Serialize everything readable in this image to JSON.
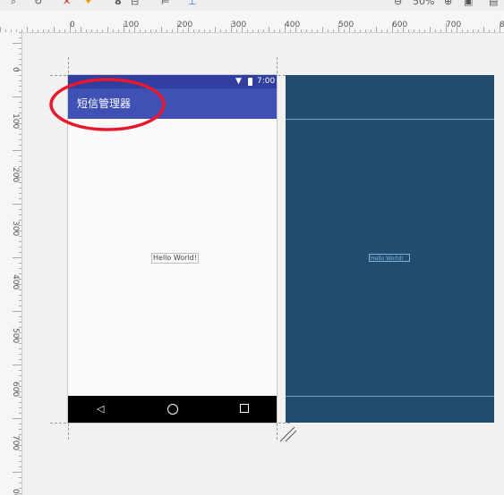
{
  "toolbar": {
    "zoom_label": "50%"
  },
  "ruler": {
    "top_labels": [
      "0",
      "100",
      "200",
      "300",
      "400",
      "500",
      "600",
      "700",
      "8"
    ],
    "left_labels": [
      "0",
      "100",
      "200",
      "300",
      "400",
      "500",
      "600",
      "700",
      "00"
    ]
  },
  "device": {
    "status_time": "7:00",
    "app_title": "短信管理器",
    "hello_text": "Hello World!"
  },
  "blueprint": {
    "hello_text": "Hello World!"
  },
  "colors": {
    "status_bar": "#303f9f",
    "app_bar": "#3f51b5",
    "blueprint_bg": "#224d6f",
    "annotation": "#e8192c"
  },
  "icons": {
    "wifi": "wifi-icon",
    "battery": "battery-icon",
    "back": "nav-back-icon",
    "home": "nav-home-icon",
    "recents": "nav-recents-icon",
    "resize": "resize-handle-icon"
  }
}
